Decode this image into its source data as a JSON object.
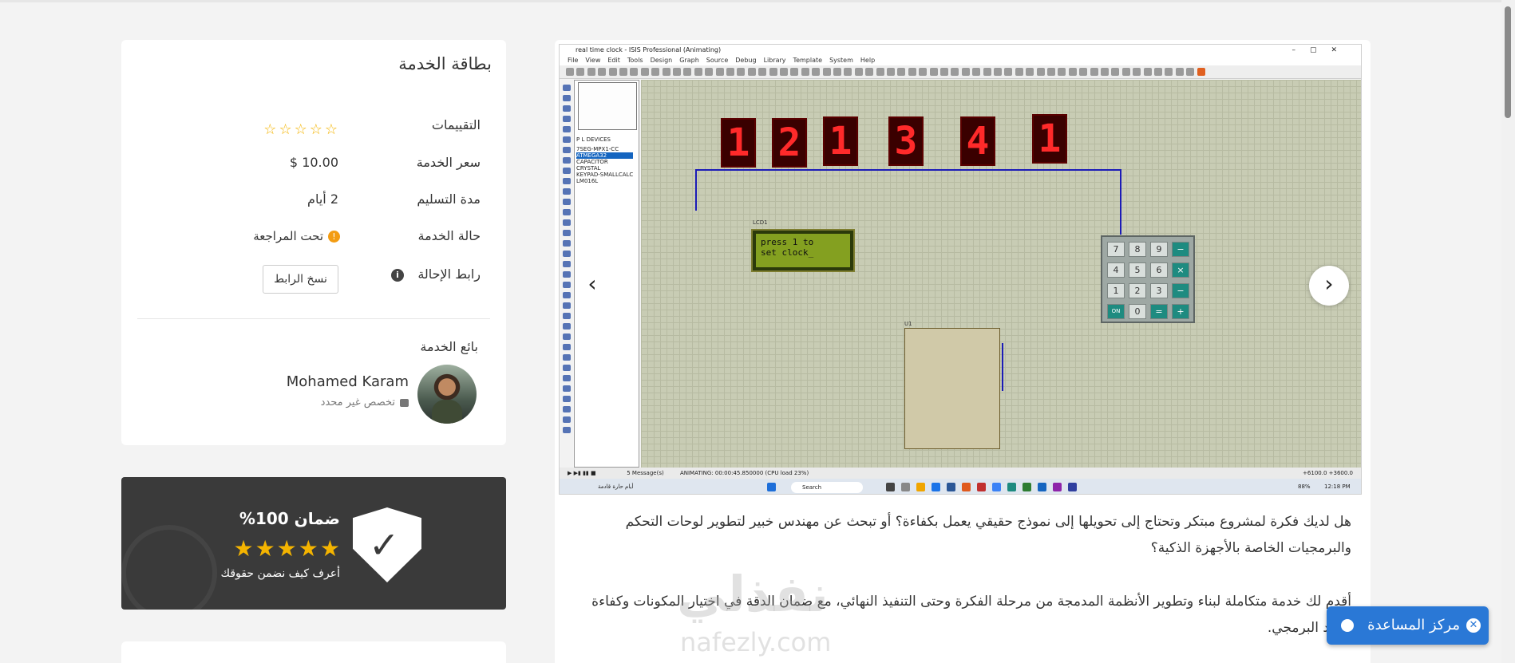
{
  "gallery": {
    "window_title": "real time clock - ISIS Professional (Animating)",
    "menu": [
      "File",
      "View",
      "Edit",
      "Tools",
      "Design",
      "Graph",
      "Source",
      "Debug",
      "Library",
      "Template",
      "System",
      "Help"
    ],
    "device_tabs": "P  L     DEVICES",
    "devices": [
      "7SEG-MPX1-CC",
      "ATMEGA32",
      "CAPACITOR",
      "CRYSTAL",
      "KEYPAD-SMALLCALC",
      "LM016L"
    ],
    "selected_device": "ATMEGA32",
    "seven_segment_digits": [
      "1",
      "2",
      "1",
      "3",
      "4",
      "1"
    ],
    "lcd_label": "LCD1",
    "lcd_line1": "press 1 to",
    "lcd_line2": "set clock_",
    "mcu_label": "U1",
    "keypad_keys": [
      "7",
      "8",
      "9",
      "−",
      "4",
      "5",
      "6",
      "×",
      "1",
      "2",
      "3",
      "−",
      "ON",
      "0",
      "=",
      "+"
    ],
    "status_messages": "5 Message(s)",
    "status_anim": "ANIMATING: 00:00:45.850000 (CPU load 23%)",
    "status_coords": "+6100.0   +3600.0",
    "taskbar_search": "Search",
    "taskbar_time": "12:18 PM",
    "taskbar_weather": "أيام حارة قادمة",
    "taskbar_battery": "88%"
  },
  "description": {
    "p1": "هل لديك فكرة لمشروع مبتكر وتحتاج إلى تحويلها إلى نموذج حقيقي يعمل بكفاءة؟ أو تبحث عن مهندس خبير لتطوير لوحات التحكم والبرمجيات الخاصة بالأجهزة الذكية؟",
    "p2": "أقدم لك خدمة متكاملة لبناء وتطوير الأنظمة المدمجة من مرحلة الفكرة وحتى التنفيذ النهائي، مع ضمان الدقة في اختيار المكونات وكفاءة الكود البرمجي."
  },
  "service_card": {
    "title": "بطاقة الخدمة",
    "ratings_label": "التقييمات",
    "ratings_value": 0,
    "price_label": "سعر الخدمة",
    "price_value": "$ 10.00",
    "delivery_label": "مدة التسليم",
    "delivery_value": "2 أيام",
    "status_label": "حالة الخدمة",
    "status_value": "تحت المراجعة",
    "referral_label": "رابط الإحالة",
    "copy_button": "نسخ الرابط",
    "seller_label": "بائع الخدمة",
    "seller_name": "Mohamed Karam",
    "seller_spec": "تخصص غير محدد"
  },
  "guarantee": {
    "title": "ضمان 100%",
    "subtitle": "أعرف كيف نضمن حقوقك",
    "stars": 5
  },
  "watermark": {
    "logo": "نفذلي",
    "url": "nafezly.com"
  },
  "help": {
    "label": "مركز المساعدة"
  },
  "colors": {
    "star": "#f4b400",
    "help": "#2a78d6",
    "guarantee_bg": "#3a3a3a",
    "status_warning": "#f39c12"
  }
}
